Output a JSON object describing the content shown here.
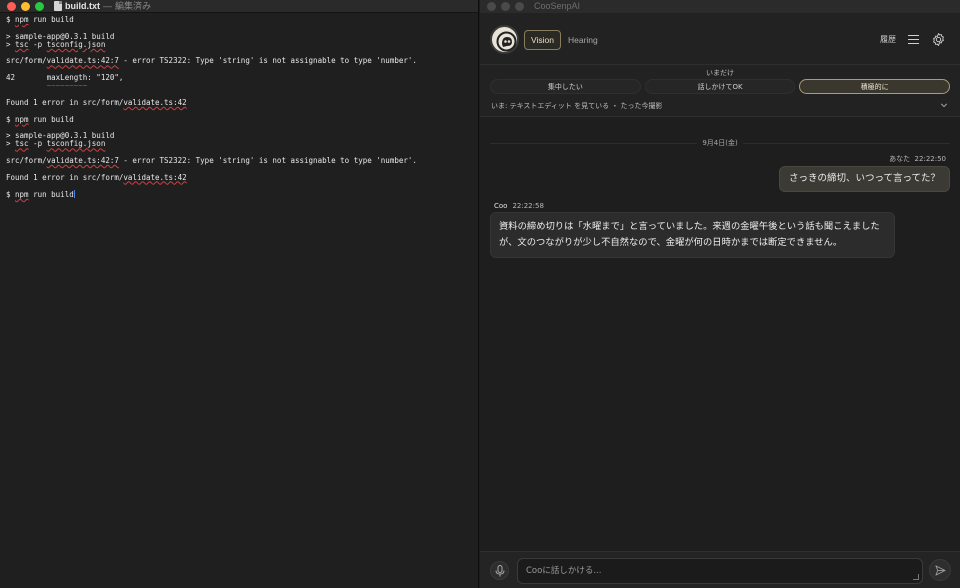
{
  "editor": {
    "filename": "build.txt",
    "separator": "—",
    "state": "編集済み",
    "lines": [
      {
        "kind": "prompt",
        "prefix": "$ ",
        "cmd": "npm",
        "rest": " run build"
      },
      {
        "kind": "blank"
      },
      {
        "kind": "plain",
        "text": "> sample-app@0.3.1 build"
      },
      {
        "kind": "tsc",
        "prefix": "> ",
        "tsc": "tsc",
        "mid": " -p ",
        "cfg": "tsconfig.json"
      },
      {
        "kind": "blank"
      },
      {
        "kind": "error",
        "pre": "src/form/",
        "file": "validate.ts:42:7",
        "post": " - error TS2322: Type 'string' is not assignable to type 'number'."
      },
      {
        "kind": "blank"
      },
      {
        "kind": "plain",
        "text": "42       maxLength: \"120\","
      },
      {
        "kind": "tilde",
        "text": "         ~~~~~~~~~"
      },
      {
        "kind": "blank"
      },
      {
        "kind": "found",
        "pre": "Found 1 error in src/form/",
        "file": "validate.ts:42"
      },
      {
        "kind": "blank"
      },
      {
        "kind": "prompt",
        "prefix": "$ ",
        "cmd": "npm",
        "rest": " run build"
      },
      {
        "kind": "blank"
      },
      {
        "kind": "plain",
        "text": "> sample-app@0.3.1 build"
      },
      {
        "kind": "tsc",
        "prefix": "> ",
        "tsc": "tsc",
        "mid": " -p ",
        "cfg": "tsconfig.json"
      },
      {
        "kind": "blank"
      },
      {
        "kind": "error",
        "pre": "src/form/",
        "file": "validate.ts:42:7",
        "post": " - error TS2322: Type 'string' is not assignable to type 'number'."
      },
      {
        "kind": "blank"
      },
      {
        "kind": "found",
        "pre": "Found 1 error in src/form/",
        "file": "validate.ts:42"
      },
      {
        "kind": "blank"
      },
      {
        "kind": "prompt",
        "prefix": "$ ",
        "cmd": "npm",
        "rest": " run build",
        "cursor": true
      }
    ]
  },
  "app": {
    "title": "CooSenpAI",
    "tabs": {
      "vision": "Vision",
      "hearing": "Hearing"
    },
    "history_label": "履歴",
    "mode": {
      "label": "いまだけ",
      "options": [
        "集中したい",
        "話しかけてOK",
        "積極的に"
      ],
      "active_index": 2
    },
    "now_status": "いま: テキストエディット を見ている ・ たった今撮影",
    "date_separator": "9月4日(金)",
    "user_message": {
      "who": "あなた",
      "time": "22:22:50",
      "text": "さっきの締切、いつって言ってた？"
    },
    "coo_message": {
      "who": "Coo",
      "time": "22:22:58",
      "line1": "資料の締め切りは「水曜まで」と言っていました。来週の金曜午後という話も聞こえました",
      "line2": "が、文のつながりが少し不自然なので、金曜が何の日時かまでは断定できません。"
    },
    "composer_placeholder": "Cooに話しかける...",
    "colors": {
      "accent": "#a89b78",
      "traffic_red": "#ff5f57",
      "traffic_yellow": "#febc2e",
      "traffic_green": "#28c840"
    },
    "icons": [
      "mic-icon",
      "send-icon",
      "gear-icon",
      "menu-icon",
      "chevron-down-icon",
      "file-icon"
    ]
  }
}
